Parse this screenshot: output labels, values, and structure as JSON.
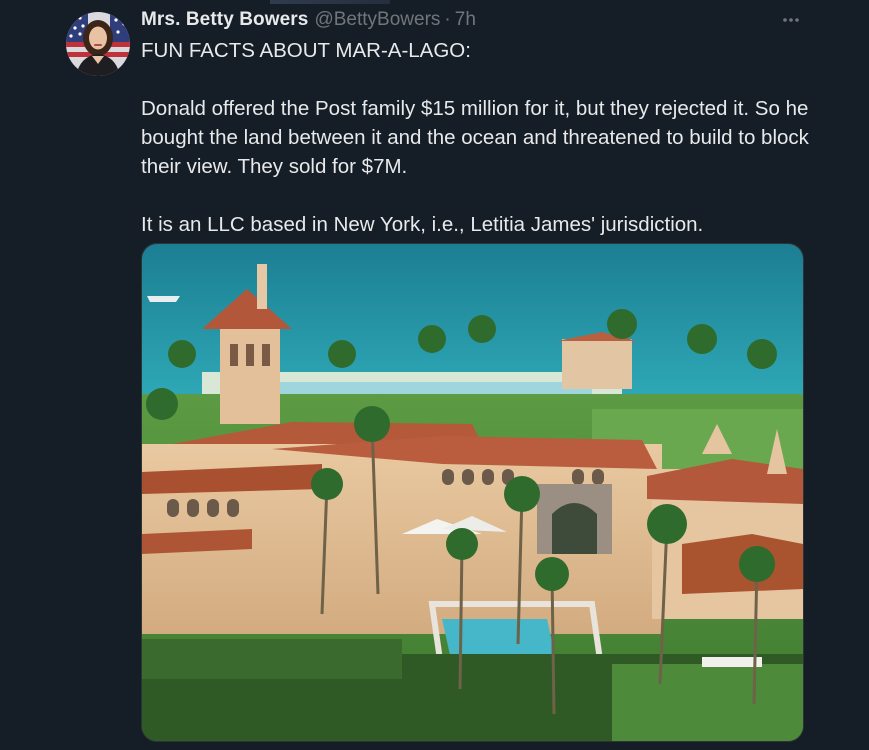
{
  "author": {
    "display_name": "Mrs. Betty Bowers",
    "handle": "@BettyBowers",
    "separator": "·",
    "time": "7h"
  },
  "tweet": {
    "lines": [
      "FUN FACTS ABOUT MAR-A-LAGO:",
      "Donald offered the Post family $15 million for it, but they rejected it. So he bought the land between it and the ocean and threatened to build to block their view. They sold for $7M.",
      "It is an LLC based in New York, i.e., Letitia James' jurisdiction."
    ]
  },
  "icons": {
    "more": "more-options-icon",
    "avatar": "profile-avatar"
  },
  "colors": {
    "background": "#151d27",
    "text_primary": "#e7e9ea",
    "text_secondary": "#71767b",
    "ocean": "#1f8fa3",
    "roof": "#b55a3c",
    "lawn": "#4f8a3a"
  }
}
